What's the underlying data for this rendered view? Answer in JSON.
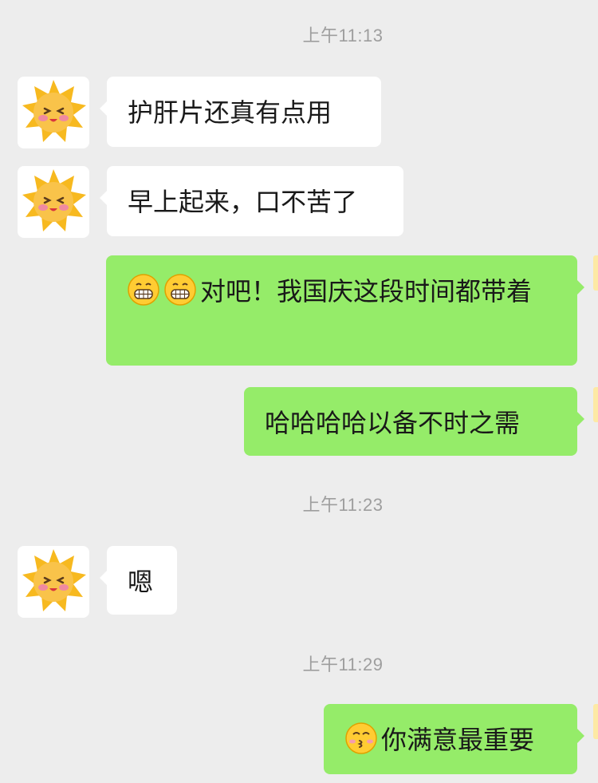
{
  "timestamps": [
    "上午11:13",
    "上午11:23",
    "上午11:29"
  ],
  "messages": [
    {
      "side": "in",
      "text": "护肝片还真有点用"
    },
    {
      "side": "in",
      "text": "早上起来，口不苦了"
    },
    {
      "side": "out",
      "emojis": [
        "grin-face-icon",
        "grin-face-icon"
      ],
      "text": "对吧！我国庆这段时间都带着"
    },
    {
      "side": "out",
      "text": "哈哈哈哈以备不时之需"
    },
    {
      "side": "in",
      "text": "嗯"
    },
    {
      "side": "out",
      "emojis": [
        "kissing-face-icon"
      ],
      "text": "你满意最重要"
    }
  ],
  "colors": {
    "background": "#ededed",
    "incoming_bubble": "#ffffff",
    "outgoing_bubble": "#95ec69",
    "timestamp": "#9e9e9e",
    "text": "#191919"
  },
  "contact_avatar_icon": "sun-avatar-icon"
}
